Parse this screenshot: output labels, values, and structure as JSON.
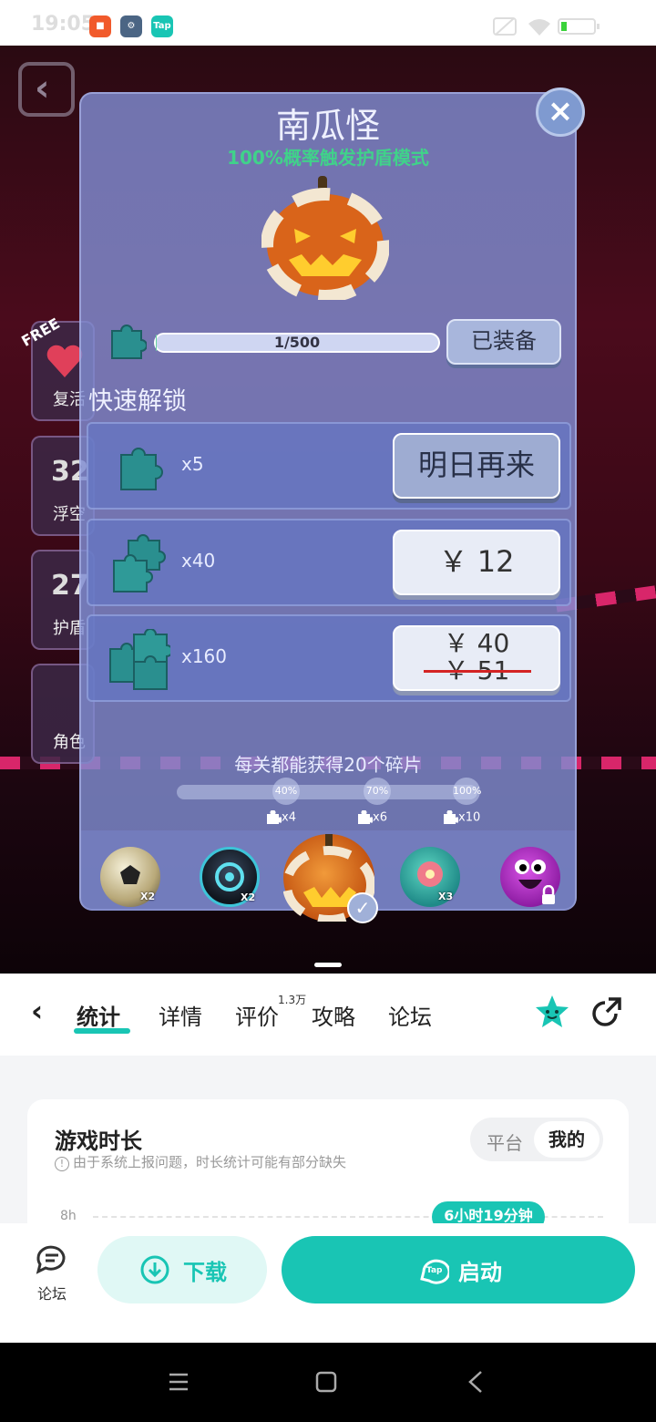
{
  "status_bar": {
    "time": "19:05",
    "apps": [
      "Tap"
    ]
  },
  "modal": {
    "title": "南瓜怪",
    "subtitle": "100%概率触发护盾模式",
    "progress": {
      "text": "1/500",
      "fraction": 0.002
    },
    "equipped_label": "已装备",
    "section_title": "快速解锁",
    "rows": [
      {
        "qty": "x5",
        "button": "明日再来"
      },
      {
        "qty": "x40",
        "button": "￥ 12"
      },
      {
        "qty": "x160",
        "price": "￥ 40",
        "old_price": "￥ 51"
      }
    ],
    "daily_text": "每关都能获得20个碎片",
    "milestones": [
      {
        "label": "40%",
        "reward": "x4"
      },
      {
        "label": "70%",
        "reward": "x6"
      },
      {
        "label": "100%",
        "reward": "x10"
      }
    ],
    "skins": [
      {
        "name": "soccer-ball",
        "badge": "X2"
      },
      {
        "name": "robot",
        "badge": "X2"
      },
      {
        "name": "pumpkin",
        "badge": ""
      },
      {
        "name": "flower-ball",
        "badge": "X3"
      },
      {
        "name": "purple-monster",
        "badge": ""
      }
    ],
    "close": "×"
  },
  "side_panel": {
    "badge": "FREE",
    "items": [
      "复活",
      "浮空",
      "护盾",
      "角色"
    ],
    "counts": [
      "32",
      "27"
    ]
  },
  "tabs": {
    "back": "‹",
    "items": [
      "统计",
      "详情",
      "评价",
      "攻略",
      "论坛"
    ],
    "review_count": "1.3万"
  },
  "stats": {
    "title": "游戏时长",
    "note": "由于系统上报问题，时长统计可能有部分缺失",
    "segment": [
      "平台",
      "我的"
    ],
    "axis_label": "8h",
    "pill": "6小时19分钟"
  },
  "actions": {
    "forum": "论坛",
    "download": "下载",
    "launch": "启动"
  },
  "colors": {
    "accent": "#19c5b4",
    "modal_bg": "#808cd2",
    "green_text": "#40d28a"
  }
}
